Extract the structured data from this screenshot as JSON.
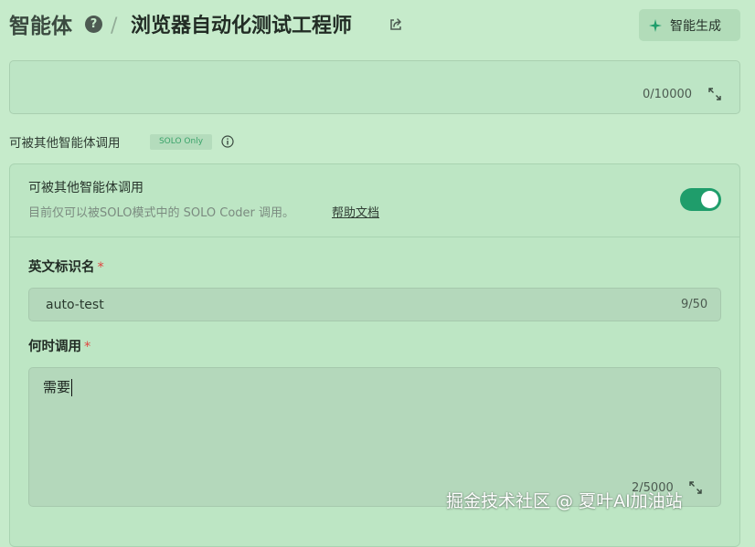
{
  "header": {
    "title": "智能体",
    "help_glyph": "?",
    "separator": "/",
    "agent_name": "浏览器自动化测试工程师",
    "share_icon": "share-icon",
    "generate_button": {
      "label": "智能生成",
      "icon": "sparkle-icon"
    }
  },
  "description": {
    "counter": "0/10000",
    "expand_icon": "expand-icon"
  },
  "invocable_section": {
    "label": "可被其他智能体调用",
    "badge": "SOLO Only",
    "info_icon": "info-icon",
    "card": {
      "toggle_title": "可被其他智能体调用",
      "toggle_description": "目前仅可以被SOLO模式中的 SOLO Coder 调用。",
      "help_link": "帮助文档",
      "toggle_on": true,
      "identifier": {
        "label": "英文标识名",
        "required_mark": "*",
        "value": "auto-test",
        "counter": "9/50"
      },
      "when_to_call": {
        "label": "何时调用",
        "required_mark": "*",
        "value": "需要",
        "counter": "2/5000",
        "expand_icon": "expand-icon"
      }
    }
  },
  "watermark": "掘金技术社区 @ 夏叶AI加油站",
  "colors": {
    "background": "#c6ebcb",
    "toggle_on": "#1f9d6b",
    "badge_text": "#3aa36a",
    "required": "#e0453f"
  }
}
